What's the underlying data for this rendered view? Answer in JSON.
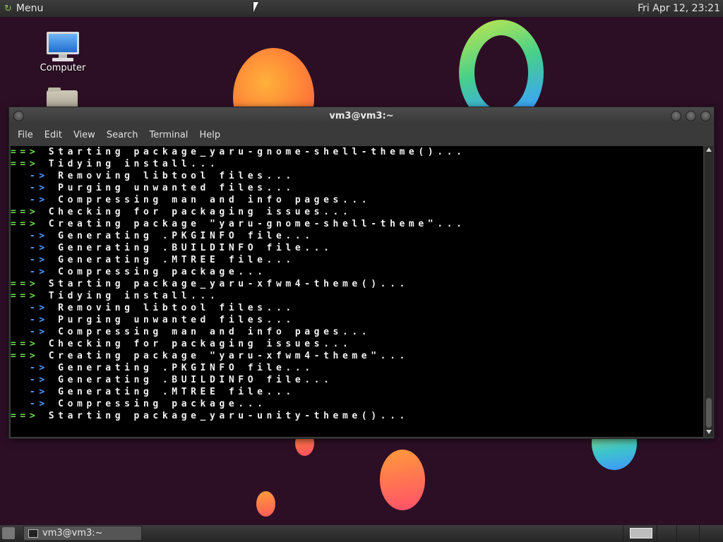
{
  "top_panel": {
    "menu_label": "Menu",
    "clock": "Fri Apr 12, 23:21"
  },
  "desktop": {
    "icons": [
      {
        "label": "Computer"
      }
    ]
  },
  "terminal": {
    "title": "vm3@vm3:~",
    "menu": [
      "File",
      "Edit",
      "View",
      "Search",
      "Terminal",
      "Help"
    ],
    "lines": [
      {
        "prefix": "==>",
        "level": "main",
        "text": "Starting package_yaru-gnome-shell-theme()..."
      },
      {
        "prefix": "==>",
        "level": "main",
        "text": "Tidying install..."
      },
      {
        "prefix": "  ->",
        "level": "sub",
        "text": "Removing libtool files..."
      },
      {
        "prefix": "  ->",
        "level": "sub",
        "text": "Purging unwanted files..."
      },
      {
        "prefix": "  ->",
        "level": "sub",
        "text": "Compressing man and info pages..."
      },
      {
        "prefix": "==>",
        "level": "main",
        "text": "Checking for packaging issues..."
      },
      {
        "prefix": "==>",
        "level": "main",
        "text": "Creating package \"yaru-gnome-shell-theme\"..."
      },
      {
        "prefix": "  ->",
        "level": "sub",
        "text": "Generating .PKGINFO file..."
      },
      {
        "prefix": "  ->",
        "level": "sub",
        "text": "Generating .BUILDINFO file..."
      },
      {
        "prefix": "  ->",
        "level": "sub",
        "text": "Generating .MTREE file..."
      },
      {
        "prefix": "  ->",
        "level": "sub",
        "text": "Compressing package..."
      },
      {
        "prefix": "==>",
        "level": "main",
        "text": "Starting package_yaru-xfwm4-theme()..."
      },
      {
        "prefix": "==>",
        "level": "main",
        "text": "Tidying install..."
      },
      {
        "prefix": "  ->",
        "level": "sub",
        "text": "Removing libtool files..."
      },
      {
        "prefix": "  ->",
        "level": "sub",
        "text": "Purging unwanted files..."
      },
      {
        "prefix": "  ->",
        "level": "sub",
        "text": "Compressing man and info pages..."
      },
      {
        "prefix": "==>",
        "level": "main",
        "text": "Checking for packaging issues..."
      },
      {
        "prefix": "==>",
        "level": "main",
        "text": "Creating package \"yaru-xfwm4-theme\"..."
      },
      {
        "prefix": "  ->",
        "level": "sub",
        "text": "Generating .PKGINFO file..."
      },
      {
        "prefix": "  ->",
        "level": "sub",
        "text": "Generating .BUILDINFO file..."
      },
      {
        "prefix": "  ->",
        "level": "sub",
        "text": "Generating .MTREE file..."
      },
      {
        "prefix": "  ->",
        "level": "sub",
        "text": "Compressing package..."
      },
      {
        "prefix": "==>",
        "level": "main",
        "text": "Starting package_yaru-unity-theme()..."
      }
    ]
  },
  "taskbar": {
    "tasks": [
      {
        "label": "vm3@vm3:~"
      }
    ]
  },
  "colors": {
    "prefix_main": "#6fe04f",
    "prefix_sub": "#4f9fff",
    "terminal_bg": "#000000",
    "desktop_bg": "#2d0f25"
  }
}
